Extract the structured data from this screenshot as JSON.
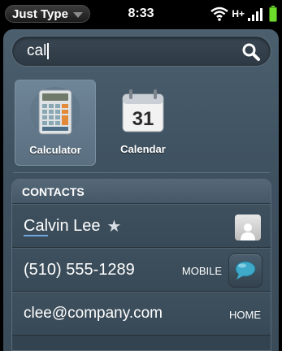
{
  "statusbar": {
    "app_menu_label": "Just Type",
    "time": "8:33",
    "network_label": "H+"
  },
  "search": {
    "value": "cal"
  },
  "apps": [
    {
      "label": "Calculator",
      "icon": "calculator-icon",
      "selected": true
    },
    {
      "label": "Calendar",
      "icon": "calendar-icon",
      "calendar_day": "31",
      "selected": false
    }
  ],
  "contacts": {
    "header": "CONTACTS",
    "name_match": "Cal",
    "name_rest": "vin Lee",
    "favorite_icon": "star-icon",
    "phone": "(510) 555-1289",
    "phone_type": "MOBILE",
    "email": "clee@company.com",
    "email_type": "HOME"
  },
  "colors": {
    "panel": "#3f5261",
    "selected_tile": "#6f8598",
    "match_underline": "#6fa8dc",
    "message_bubble": "#3fa9c9",
    "battery": "#6ddc2a"
  }
}
